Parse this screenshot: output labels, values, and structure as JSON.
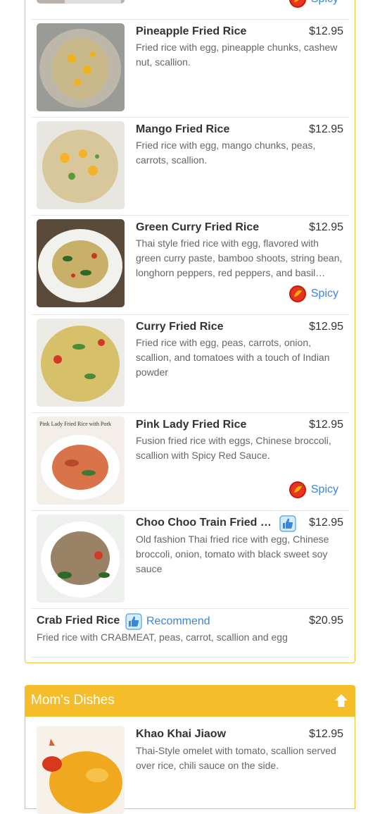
{
  "items": [
    {
      "spicy_label": "Spicy"
    },
    {
      "name": "Pineapple Fried Rice",
      "price": "$12.95",
      "desc": "Fried rice with egg, pineapple chunks, cashew nut, scallion."
    },
    {
      "name": "Mango Fried Rice",
      "price": "$12.95",
      "desc": "Fried rice with egg, mango chunks, peas, carrots, scallion."
    },
    {
      "name": "Green Curry Fried Rice",
      "price": "$12.95",
      "desc": "Thai style fried rice with egg, flavored with green curry paste, bamboo shoots, string bean, longhorn peppers, red peppers, and basil…",
      "spicy_label": "Spicy"
    },
    {
      "name": "Curry Fried Rice",
      "price": "$12.95",
      "desc": "Fried rice with egg, peas, carrots, onion, scallion, and tomatoes with a touch of Indian powder"
    },
    {
      "name": "Pink Lady Fried Rice",
      "price": "$12.95",
      "desc": "Fusion fried rice with eggs, Chinese broccoli, scallion with Spicy Red Sauce.",
      "spicy_label": "Spicy",
      "photo_caption": "Pink Lady Fried Rice with Pork"
    },
    {
      "name": "Choo Choo Train Fried Rice",
      "price": "$12.95",
      "desc": "Old fashion Thai fried rice with egg, Chinese broccoli, onion, tomato with black sweet soy sauce"
    },
    {
      "name": "Crab Fried Rice",
      "price": "$20.95",
      "desc": "Fried rice with CRABMEAT, peas, carrot, scallion and egg",
      "recommend_label": "Recommend"
    }
  ],
  "section2": {
    "title": "Mom's Dishes",
    "items": [
      {
        "name": "Khao Khai Jiaow",
        "price": "$12.95",
        "desc": "Thai-Style omelet with tomato, scallion served over rice, chili sauce on the side."
      }
    ]
  },
  "colors": {
    "accent": "#f6bd2a",
    "link": "#3a86d8",
    "pepper": "#d9201a"
  },
  "icons": {
    "spicy": "chili-pepper-icon",
    "recommend": "thumbs-up-icon",
    "up": "arrow-up-icon"
  }
}
